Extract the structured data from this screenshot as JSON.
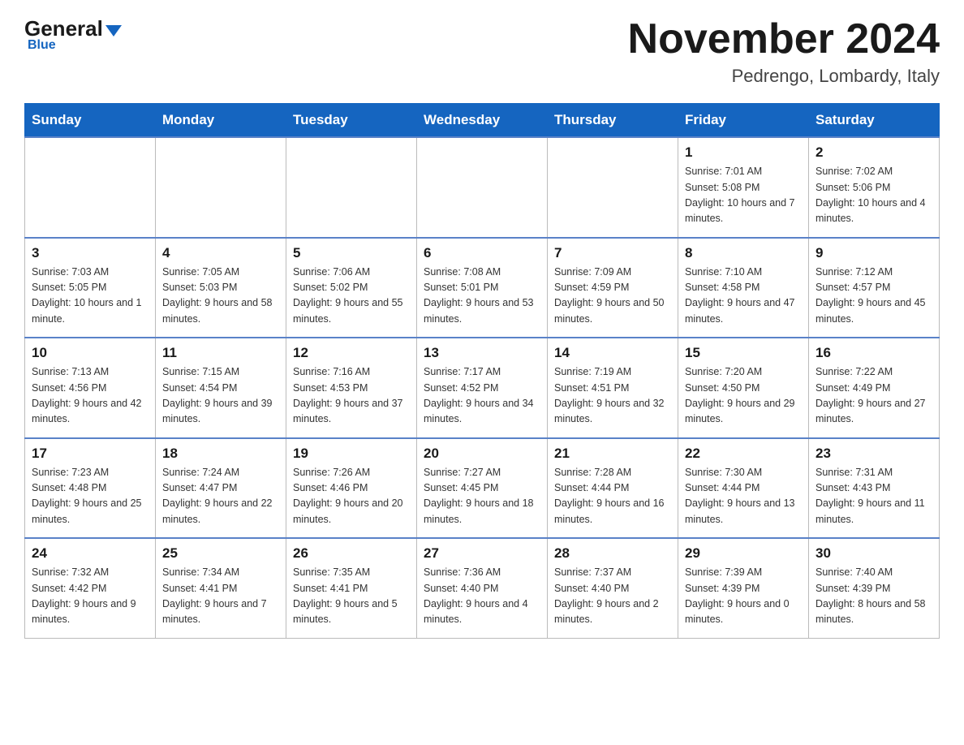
{
  "header": {
    "logo": {
      "general": "General",
      "blue": "Blue"
    },
    "title": "November 2024",
    "location": "Pedrengo, Lombardy, Italy"
  },
  "days_of_week": [
    "Sunday",
    "Monday",
    "Tuesday",
    "Wednesday",
    "Thursday",
    "Friday",
    "Saturday"
  ],
  "weeks": [
    [
      {
        "day": "",
        "info": ""
      },
      {
        "day": "",
        "info": ""
      },
      {
        "day": "",
        "info": ""
      },
      {
        "day": "",
        "info": ""
      },
      {
        "day": "",
        "info": ""
      },
      {
        "day": "1",
        "info": "Sunrise: 7:01 AM\nSunset: 5:08 PM\nDaylight: 10 hours and 7 minutes."
      },
      {
        "day": "2",
        "info": "Sunrise: 7:02 AM\nSunset: 5:06 PM\nDaylight: 10 hours and 4 minutes."
      }
    ],
    [
      {
        "day": "3",
        "info": "Sunrise: 7:03 AM\nSunset: 5:05 PM\nDaylight: 10 hours and 1 minute."
      },
      {
        "day": "4",
        "info": "Sunrise: 7:05 AM\nSunset: 5:03 PM\nDaylight: 9 hours and 58 minutes."
      },
      {
        "day": "5",
        "info": "Sunrise: 7:06 AM\nSunset: 5:02 PM\nDaylight: 9 hours and 55 minutes."
      },
      {
        "day": "6",
        "info": "Sunrise: 7:08 AM\nSunset: 5:01 PM\nDaylight: 9 hours and 53 minutes."
      },
      {
        "day": "7",
        "info": "Sunrise: 7:09 AM\nSunset: 4:59 PM\nDaylight: 9 hours and 50 minutes."
      },
      {
        "day": "8",
        "info": "Sunrise: 7:10 AM\nSunset: 4:58 PM\nDaylight: 9 hours and 47 minutes."
      },
      {
        "day": "9",
        "info": "Sunrise: 7:12 AM\nSunset: 4:57 PM\nDaylight: 9 hours and 45 minutes."
      }
    ],
    [
      {
        "day": "10",
        "info": "Sunrise: 7:13 AM\nSunset: 4:56 PM\nDaylight: 9 hours and 42 minutes."
      },
      {
        "day": "11",
        "info": "Sunrise: 7:15 AM\nSunset: 4:54 PM\nDaylight: 9 hours and 39 minutes."
      },
      {
        "day": "12",
        "info": "Sunrise: 7:16 AM\nSunset: 4:53 PM\nDaylight: 9 hours and 37 minutes."
      },
      {
        "day": "13",
        "info": "Sunrise: 7:17 AM\nSunset: 4:52 PM\nDaylight: 9 hours and 34 minutes."
      },
      {
        "day": "14",
        "info": "Sunrise: 7:19 AM\nSunset: 4:51 PM\nDaylight: 9 hours and 32 minutes."
      },
      {
        "day": "15",
        "info": "Sunrise: 7:20 AM\nSunset: 4:50 PM\nDaylight: 9 hours and 29 minutes."
      },
      {
        "day": "16",
        "info": "Sunrise: 7:22 AM\nSunset: 4:49 PM\nDaylight: 9 hours and 27 minutes."
      }
    ],
    [
      {
        "day": "17",
        "info": "Sunrise: 7:23 AM\nSunset: 4:48 PM\nDaylight: 9 hours and 25 minutes."
      },
      {
        "day": "18",
        "info": "Sunrise: 7:24 AM\nSunset: 4:47 PM\nDaylight: 9 hours and 22 minutes."
      },
      {
        "day": "19",
        "info": "Sunrise: 7:26 AM\nSunset: 4:46 PM\nDaylight: 9 hours and 20 minutes."
      },
      {
        "day": "20",
        "info": "Sunrise: 7:27 AM\nSunset: 4:45 PM\nDaylight: 9 hours and 18 minutes."
      },
      {
        "day": "21",
        "info": "Sunrise: 7:28 AM\nSunset: 4:44 PM\nDaylight: 9 hours and 16 minutes."
      },
      {
        "day": "22",
        "info": "Sunrise: 7:30 AM\nSunset: 4:44 PM\nDaylight: 9 hours and 13 minutes."
      },
      {
        "day": "23",
        "info": "Sunrise: 7:31 AM\nSunset: 4:43 PM\nDaylight: 9 hours and 11 minutes."
      }
    ],
    [
      {
        "day": "24",
        "info": "Sunrise: 7:32 AM\nSunset: 4:42 PM\nDaylight: 9 hours and 9 minutes."
      },
      {
        "day": "25",
        "info": "Sunrise: 7:34 AM\nSunset: 4:41 PM\nDaylight: 9 hours and 7 minutes."
      },
      {
        "day": "26",
        "info": "Sunrise: 7:35 AM\nSunset: 4:41 PM\nDaylight: 9 hours and 5 minutes."
      },
      {
        "day": "27",
        "info": "Sunrise: 7:36 AM\nSunset: 4:40 PM\nDaylight: 9 hours and 4 minutes."
      },
      {
        "day": "28",
        "info": "Sunrise: 7:37 AM\nSunset: 4:40 PM\nDaylight: 9 hours and 2 minutes."
      },
      {
        "day": "29",
        "info": "Sunrise: 7:39 AM\nSunset: 4:39 PM\nDaylight: 9 hours and 0 minutes."
      },
      {
        "day": "30",
        "info": "Sunrise: 7:40 AM\nSunset: 4:39 PM\nDaylight: 8 hours and 58 minutes."
      }
    ]
  ]
}
